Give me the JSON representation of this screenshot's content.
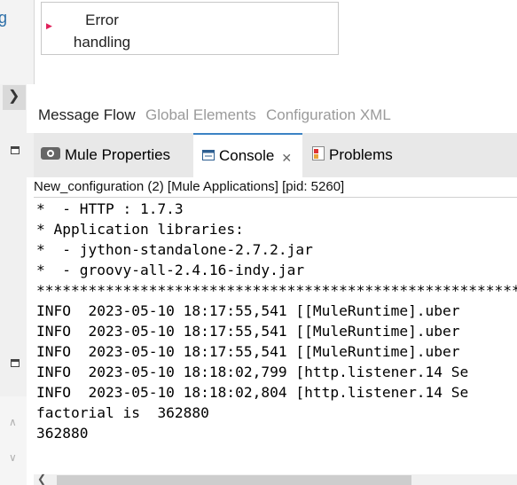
{
  "flow_element": {
    "label": "Error handling"
  },
  "left": {
    "g_glyph": "g"
  },
  "editor_tabs": [
    {
      "label": "Message Flow",
      "state": "active"
    },
    {
      "label": "Global Elements",
      "state": "inactive"
    },
    {
      "label": "Configuration XML",
      "state": "inactive"
    }
  ],
  "view_tabs": [
    {
      "label": "Mule Properties",
      "icon": "mule-properties-icon",
      "active": false
    },
    {
      "label": "Console",
      "icon": "console-icon",
      "active": true
    },
    {
      "label": "Problems",
      "icon": "problems-icon",
      "active": false
    }
  ],
  "console": {
    "header": "New_configuration (2) [Mule Applications]  [pid: 5260]",
    "lines": [
      "*  - HTTP : 1.7.3",
      "* Application libraries:",
      "*  - jython-standalone-2.7.2.jar",
      "*  - groovy-all-2.4.16-indy.jar",
      "**************************************************************",
      "INFO  2023-05-10 18:17:55,541 [[MuleRuntime].uber",
      "INFO  2023-05-10 18:17:55,541 [[MuleRuntime].uber",
      "INFO  2023-05-10 18:17:55,541 [[MuleRuntime].uber",
      "INFO  2023-05-10 18:18:02,799 [http.listener.14 Se",
      "INFO  2023-05-10 18:18:02,804 [http.listener.14 Se",
      "factorial is  362880",
      "362880"
    ]
  },
  "colors": {
    "accent": "#3b83c4",
    "flow_arrow": "#e0205a"
  }
}
